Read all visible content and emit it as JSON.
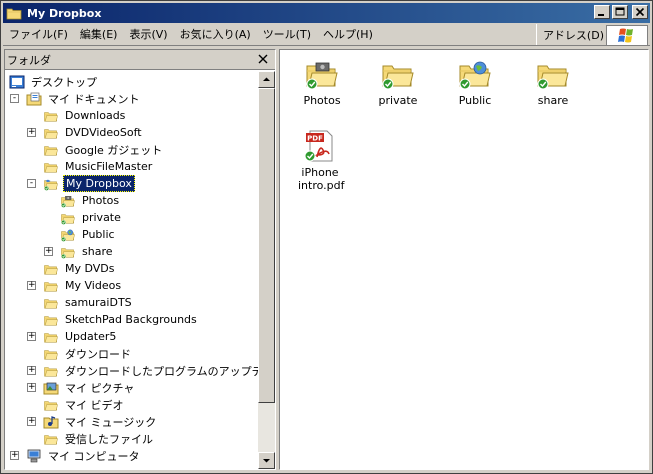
{
  "window": {
    "title": "My Dropbox"
  },
  "menu": {
    "items": [
      "ファイル(F)",
      "編集(E)",
      "表示(V)",
      "お気に入り(A)",
      "ツール(T)",
      "ヘルプ(H)"
    ],
    "address_label": "アドレス(D)"
  },
  "folder_pane": {
    "title": "フォルダ",
    "tree": [
      {
        "label": "デスクトップ",
        "level": 0,
        "expander": "",
        "icon": "desktop-icon"
      },
      {
        "label": "マイ ドキュメント",
        "level": 1,
        "expander": "-",
        "icon": "my-documents-icon"
      },
      {
        "label": "Downloads",
        "level": 2,
        "expander": "",
        "icon": "folder-icon"
      },
      {
        "label": "DVDVideoSoft",
        "level": 2,
        "expander": "+",
        "icon": "folder-icon"
      },
      {
        "label": "Google ガジェット",
        "level": 2,
        "expander": "",
        "icon": "folder-icon"
      },
      {
        "label": "MusicFileMaster",
        "level": 2,
        "expander": "",
        "icon": "folder-icon"
      },
      {
        "label": "My Dropbox",
        "level": 2,
        "expander": "-",
        "icon": "dropbox-folder-icon",
        "selected": true
      },
      {
        "label": "Photos",
        "level": 3,
        "expander": "",
        "icon": "synced-photos-folder-icon"
      },
      {
        "label": "private",
        "level": 3,
        "expander": "",
        "icon": "synced-folder-icon"
      },
      {
        "label": "Public",
        "level": 3,
        "expander": "",
        "icon": "synced-public-folder-icon"
      },
      {
        "label": "share",
        "level": 3,
        "expander": "+",
        "icon": "synced-folder-icon"
      },
      {
        "label": "My DVDs",
        "level": 2,
        "expander": "",
        "icon": "folder-icon"
      },
      {
        "label": "My Videos",
        "level": 2,
        "expander": "+",
        "icon": "folder-icon"
      },
      {
        "label": "samuraiDTS",
        "level": 2,
        "expander": "",
        "icon": "folder-icon"
      },
      {
        "label": "SketchPad Backgrounds",
        "level": 2,
        "expander": "",
        "icon": "folder-icon"
      },
      {
        "label": "Updater5",
        "level": 2,
        "expander": "+",
        "icon": "folder-icon"
      },
      {
        "label": "ダウンロード",
        "level": 2,
        "expander": "",
        "icon": "folder-icon"
      },
      {
        "label": "ダウンロードしたプログラムのアップデート",
        "level": 2,
        "expander": "+",
        "icon": "folder-icon"
      },
      {
        "label": "マイ ピクチャ",
        "level": 2,
        "expander": "+",
        "icon": "my-pictures-icon"
      },
      {
        "label": "マイ ビデオ",
        "level": 2,
        "expander": "",
        "icon": "folder-icon"
      },
      {
        "label": "マイ ミュージック",
        "level": 2,
        "expander": "+",
        "icon": "my-music-icon"
      },
      {
        "label": "受信したファイル",
        "level": 2,
        "expander": "",
        "icon": "folder-icon"
      },
      {
        "label": "マイ コンピュータ",
        "level": 1,
        "expander": "+",
        "icon": "my-computer-icon"
      }
    ]
  },
  "content": {
    "items": [
      {
        "label": "Photos",
        "icon": "synced-photos-folder-icon"
      },
      {
        "label": "private",
        "icon": "synced-folder-icon"
      },
      {
        "label": "Public",
        "icon": "synced-public-folder-icon"
      },
      {
        "label": "share",
        "icon": "synced-folder-icon"
      },
      {
        "label": "iPhone intro.pdf",
        "icon": "synced-pdf-icon"
      }
    ]
  },
  "colors": {
    "title_start": "#0a246a",
    "title_end": "#3a6ea5",
    "face": "#d4d0c8",
    "folder": "#f5d978",
    "sync_green": "#2f9a2f",
    "selection": "#0a246a"
  }
}
